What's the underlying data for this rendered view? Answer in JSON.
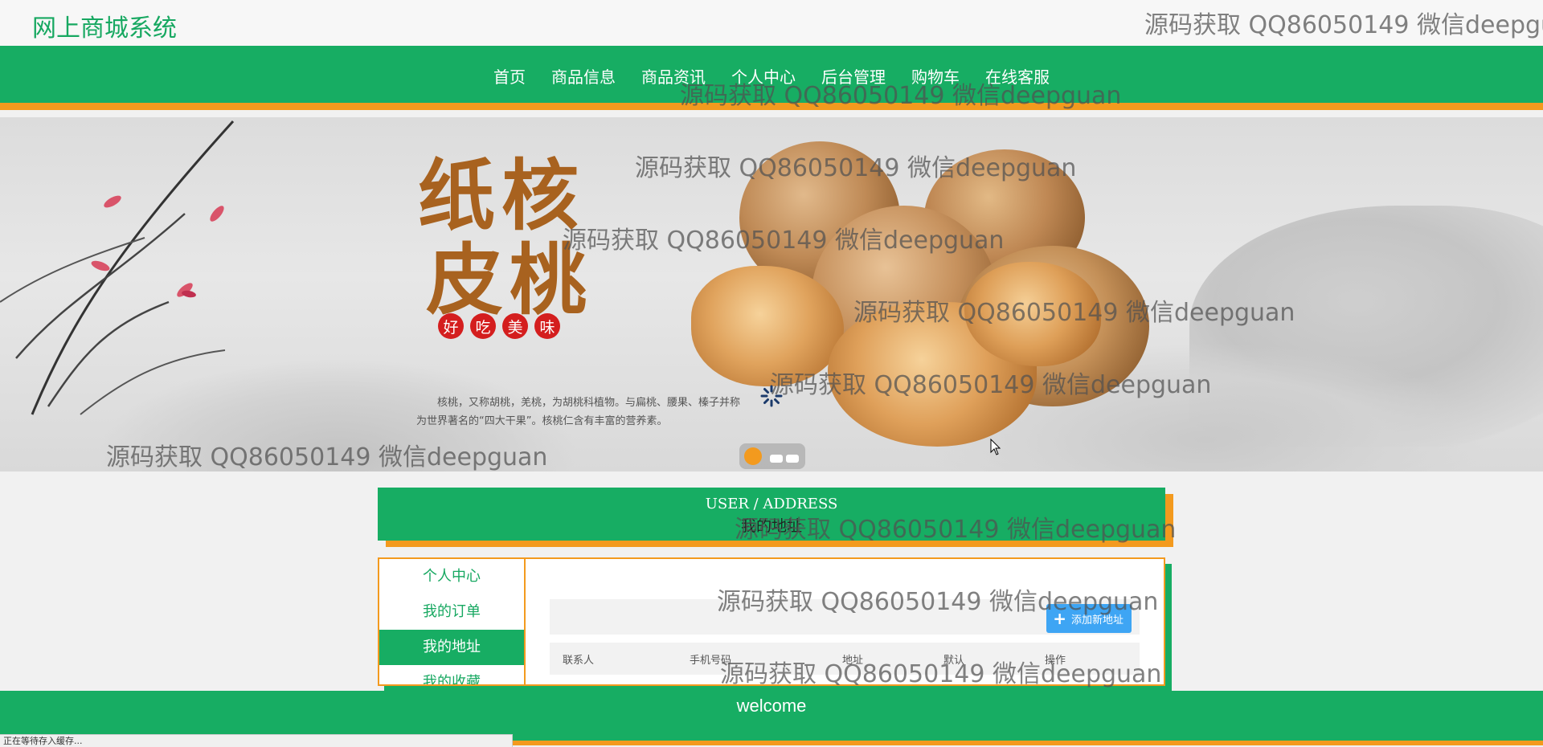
{
  "site": {
    "title": "网上商城系统"
  },
  "nav": {
    "items": [
      "首页",
      "商品信息",
      "商品资讯",
      "个人中心",
      "后台管理",
      "购物车",
      "在线客服"
    ]
  },
  "banner": {
    "headline_1": "纸核",
    "headline_2": "皮桃",
    "tags": [
      "好",
      "吃",
      "美",
      "味"
    ],
    "description": "核桃，又称胡桃，羌桃，为胡桃科植物。与扁桃、腰果、榛子并称为世界著名的“四大干果”。核桃仁含有丰富的营养素。",
    "slide_count": 3,
    "active_slide": 1
  },
  "section": {
    "title_en": "USER / ADDRESS",
    "title_cn": "我的地址"
  },
  "sidebar": {
    "items": [
      {
        "label": "个人中心",
        "active": false
      },
      {
        "label": "我的订单",
        "active": false
      },
      {
        "label": "我的地址",
        "active": true
      },
      {
        "label": "我的收藏",
        "active": false
      }
    ]
  },
  "toolbar": {
    "add_label": "添加新地址"
  },
  "table": {
    "columns": [
      "联系人",
      "手机号码",
      "地址",
      "默认",
      "操作"
    ]
  },
  "footer": {
    "text": "welcome"
  },
  "statusbar": {
    "text": "正在等待存入缓存..."
  },
  "watermark": "源码获取 QQ86050149 微信deepguan",
  "colors": {
    "primary": "#17ad63",
    "accent": "#f39a1e",
    "button": "#3ea5f4"
  }
}
